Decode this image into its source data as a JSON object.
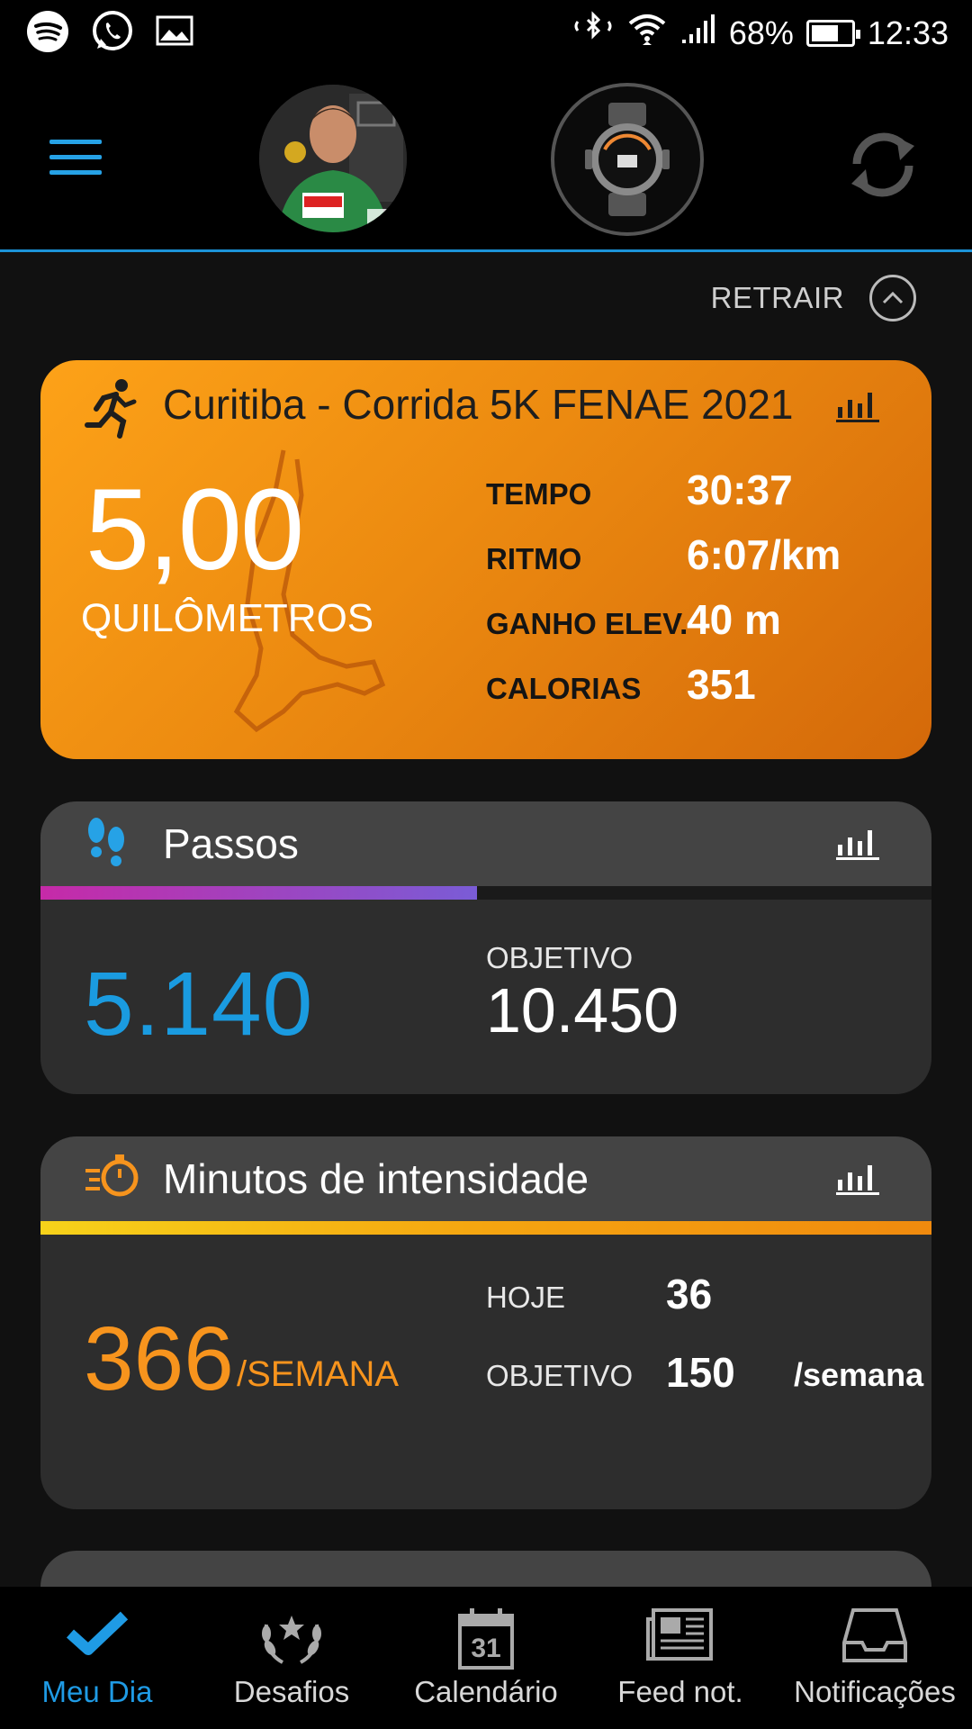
{
  "status_bar": {
    "battery": "68%",
    "time": "12:33",
    "icons": [
      "spotify-icon",
      "whatsapp-icon",
      "gallery-icon",
      "bluetooth-icon",
      "wifi-icon",
      "signal-icon",
      "battery-icon"
    ]
  },
  "header": {
    "icons": [
      "menu-icon",
      "profile-avatar",
      "watch-icon",
      "sync-icon"
    ]
  },
  "collapse": {
    "label": "RETRAIR"
  },
  "activity": {
    "title": "Curitiba - Corrida 5K FENAE 2021",
    "distance": "5,00",
    "distance_unit": "QUILÔMETROS",
    "stats": [
      {
        "label": "TEMPO",
        "value": "30:37"
      },
      {
        "label": "RITMO",
        "value": "6:07/km"
      },
      {
        "label": "GANHO ELEV.",
        "value": "40 m"
      },
      {
        "label": "CALORIAS",
        "value": "351"
      }
    ],
    "color_start": "#fda218",
    "color_end": "#d4690a"
  },
  "steps": {
    "title": "Passos",
    "value": "5.140",
    "goal_label": "OBJETIVO",
    "goal_value": "10.450",
    "progress": 0.49,
    "color": "#1a9be0"
  },
  "intensity": {
    "title": "Minutos de intensidade",
    "value": "366",
    "unit": "/SEMANA",
    "today_label": "HOJE",
    "today_value": "36",
    "goal_label": "OBJETIVO",
    "goal_value": "150",
    "goal_unit": "/semana",
    "progress": 1.0,
    "color": "#f7941d",
    "check_color": "#5fd21f"
  },
  "nav": {
    "items": [
      {
        "label": "Meu Dia",
        "icon": "check-icon",
        "active": true
      },
      {
        "label": "Desafios",
        "icon": "laurel-icon",
        "active": false
      },
      {
        "label": "Calendário",
        "icon": "calendar-icon",
        "calendar_day": "31",
        "active": false
      },
      {
        "label": "Feed not.",
        "icon": "newsfeed-icon",
        "active": false
      },
      {
        "label": "Notificações",
        "icon": "inbox-icon",
        "active": false
      }
    ]
  }
}
